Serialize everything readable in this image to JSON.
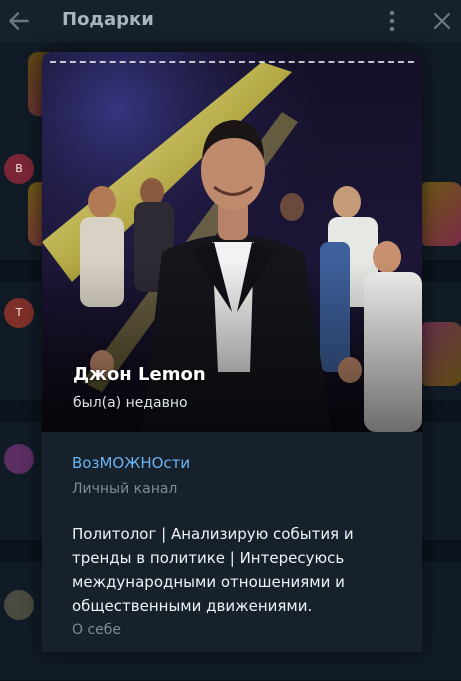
{
  "header": {
    "title": "Подарки",
    "back_icon": "arrow-left-icon",
    "more_icon": "more-vertical-icon",
    "close_icon": "close-icon"
  },
  "background_list": {
    "avatars": [
      {
        "letter": "В",
        "color": "#c0425a"
      },
      {
        "letter": "Т",
        "color": "#d9564c"
      }
    ]
  },
  "profile": {
    "name": "Джон Lemon",
    "status": "был(а) недавно",
    "channel": {
      "name": "ВозМОЖНОсти",
      "caption": "Личный канал"
    },
    "bio": {
      "text": "Политолог | Анализирую события и тренды в политике | Интересуюсь международными отношениями и общественными движениями.",
      "caption": "О себе"
    }
  },
  "colors": {
    "background": "#0e1621",
    "header": "#17212b",
    "card": "#17212b",
    "link": "#6ab3f3",
    "muted": "#7c8b99"
  }
}
